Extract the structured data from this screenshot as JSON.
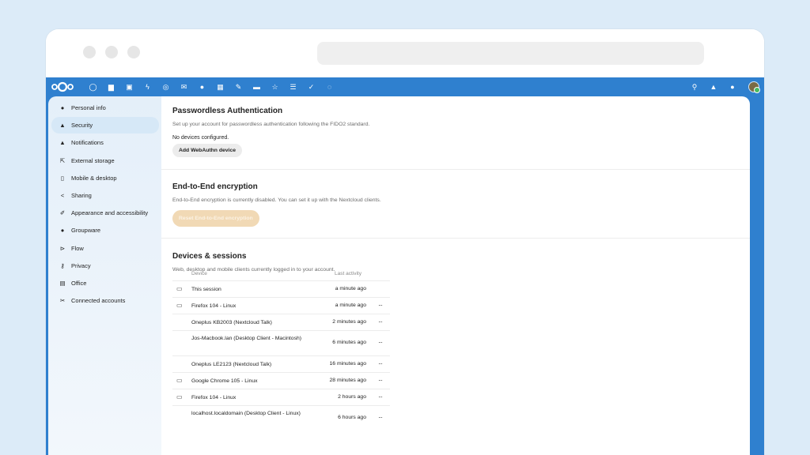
{
  "topbar": {
    "apps": [
      {
        "name": "dashboard-icon",
        "glyph": "◯"
      },
      {
        "name": "files-icon",
        "glyph": "▆"
      },
      {
        "name": "photos-icon",
        "glyph": "▣"
      },
      {
        "name": "activity-icon",
        "glyph": "ϟ"
      },
      {
        "name": "talk-icon",
        "glyph": "◎"
      },
      {
        "name": "mail-icon",
        "glyph": "✉"
      },
      {
        "name": "contacts-icon",
        "glyph": "●"
      },
      {
        "name": "calendar-icon",
        "glyph": "▦"
      },
      {
        "name": "notes-icon",
        "glyph": "✎"
      },
      {
        "name": "deck-icon",
        "glyph": "▬"
      },
      {
        "name": "bookmarks-icon",
        "glyph": "☆"
      },
      {
        "name": "tasks-icon",
        "glyph": "☰"
      },
      {
        "name": "checkmark-icon",
        "glyph": "✓"
      },
      {
        "name": "maps-icon",
        "glyph": "◌"
      }
    ],
    "right": [
      {
        "name": "search-icon",
        "glyph": "⚲"
      },
      {
        "name": "notifications-icon",
        "glyph": "▲"
      },
      {
        "name": "contacts-menu-icon",
        "glyph": "●"
      }
    ]
  },
  "sidebar": {
    "items": [
      {
        "label": "Personal info",
        "icon": "person-icon",
        "glyph": "●",
        "active": false
      },
      {
        "label": "Security",
        "icon": "lock-icon",
        "glyph": "▲",
        "active": true
      },
      {
        "label": "Notifications",
        "icon": "bell-icon",
        "glyph": "▲",
        "active": false
      },
      {
        "label": "External storage",
        "icon": "external-link-icon",
        "glyph": "⇱",
        "active": false
      },
      {
        "label": "Mobile & desktop",
        "icon": "phone-icon",
        "glyph": "▯",
        "active": false
      },
      {
        "label": "Sharing",
        "icon": "share-icon",
        "glyph": "<",
        "active": false
      },
      {
        "label": "Appearance and accessibility",
        "icon": "paint-icon",
        "glyph": "✐",
        "active": false
      },
      {
        "label": "Groupware",
        "icon": "groupware-icon",
        "glyph": "●",
        "active": false
      },
      {
        "label": "Flow",
        "icon": "flow-icon",
        "glyph": "⊳",
        "active": false
      },
      {
        "label": "Privacy",
        "icon": "key-icon",
        "glyph": "⚷",
        "active": false
      },
      {
        "label": "Office",
        "icon": "document-icon",
        "glyph": "▤",
        "active": false
      },
      {
        "label": "Connected accounts",
        "icon": "wrench-icon",
        "glyph": "✂",
        "active": false
      }
    ]
  },
  "passwordless": {
    "title": "Passwordless Authentication",
    "description": "Set up your account for passwordless authentication following the FIDO2 standard.",
    "status": "No devices configured.",
    "button": "Add WebAuthn device"
  },
  "e2e": {
    "title": "End-to-End encryption",
    "description": "End-to-End encryption is currently disabled. You can set it up with the Nextcloud clients.",
    "button": "Reset End-to-End encryption"
  },
  "devices": {
    "title": "Devices & sessions",
    "description": "Web, desktop and mobile clients currently logged in to your account.",
    "col_device": "Device",
    "col_activity": "Last activity",
    "rows": [
      {
        "name": "This session",
        "time": "a minute ago",
        "icon": "monitor-icon",
        "glyph": "▭",
        "more": false
      },
      {
        "name": "Firefox 104 - Linux",
        "time": "a minute ago",
        "icon": "monitor-icon",
        "glyph": "▭",
        "more": true
      },
      {
        "name": "Oneplus KB2003 (Nextcloud Talk)",
        "time": "2 minutes ago",
        "icon": "",
        "glyph": "",
        "more": true
      },
      {
        "name": "Jos-Macbook.lan (Desktop Client - Macintosh)",
        "time": "6 minutes ago",
        "icon": "",
        "glyph": "",
        "more": true
      },
      {
        "name": "Oneplus LE2123 (Nextcloud Talk)",
        "time": "16 minutes ago",
        "icon": "",
        "glyph": "",
        "more": true
      },
      {
        "name": "Google Chrome 105 - Linux",
        "time": "28 minutes ago",
        "icon": "monitor-icon",
        "glyph": "▭",
        "more": true
      },
      {
        "name": "Firefox 104 - Linux",
        "time": "2 hours ago",
        "icon": "monitor-icon",
        "glyph": "▭",
        "more": true
      },
      {
        "name": "localhost.localdomain (Desktop Client - Linux)",
        "time": "6 hours ago",
        "icon": "",
        "glyph": "",
        "more": true
      }
    ],
    "more_glyph": "···"
  },
  "colors": {
    "brand_blue": "#2f80cf",
    "page_bg": "#dcebf8",
    "sidebar_active": "#d6e8f7",
    "disabled_button": "#f1d9b5"
  }
}
